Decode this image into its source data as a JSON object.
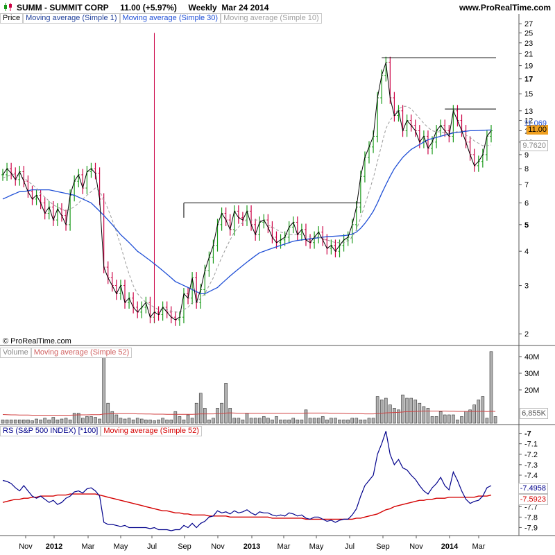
{
  "header": {
    "title": "SUMM - SUMMIT CORP     11.00 (+5.97%)     Weekly  Mar 24 2014",
    "site": "www.ProRealTime.com"
  },
  "copyright": "© ProRealTime.com",
  "legends": {
    "price": [
      "Price",
      "Moving average (Simple 1)",
      "Moving average (Simple 30)",
      "Moving average (Simple 10)"
    ],
    "volume": [
      "Volume",
      "Moving average (Simple 52)"
    ],
    "rs": [
      "RS (S&P 500 INDEX) [*100]",
      "Moving average (Simple 52)"
    ]
  },
  "value_tags": {
    "price_last": "11.00",
    "ma10_last": "9.7620",
    "ma30_last": "11.069",
    "volume_ma": "6,855K",
    "rs_last": "-7.4958",
    "rs_ma": "-7.5923"
  },
  "colors": {
    "up_bar": "#1a9a1a",
    "down_bar": "#cc0044",
    "ma1": "#000000",
    "ma30": "#1f4fd6",
    "ma10": "#9a9a9a",
    "rs_line": "#00008b",
    "rs_ma": "#d40000",
    "vol_bar": "#b0b0b0",
    "vol_ma": "#d04040",
    "price_tag_bg": "#f0a020"
  },
  "chart_data": [
    {
      "type": "line",
      "title": "SUMM - SUMMIT CORP",
      "panel": "price",
      "scale": "log",
      "ylim": [
        1.9,
        28
      ],
      "y_ticks": [
        2,
        3,
        4,
        5,
        6,
        7,
        8,
        9,
        10,
        11,
        12,
        13,
        15,
        17,
        19,
        21,
        23,
        25,
        27
      ],
      "x_ticks": [
        "Nov",
        "2012",
        "Mar",
        "May",
        "Jul",
        "Sep",
        "Nov",
        "2013",
        "Mar",
        "May",
        "Jul",
        "Sep",
        "Nov",
        "2014",
        "Mar"
      ],
      "series": [
        {
          "name": "Moving average (Simple 1)",
          "values": [
            7.6,
            8.0,
            7.7,
            7.3,
            7.8,
            7.2,
            6.6,
            6.2,
            6.4,
            6.0,
            5.5,
            5.8,
            5.2,
            5.7,
            5.4,
            5.0,
            6.4,
            7.2,
            7.6,
            6.8,
            7.8,
            8.0,
            7.7,
            6.2,
            3.5,
            3.2,
            3.0,
            2.8,
            3.0,
            2.6,
            2.7,
            2.5,
            2.4,
            2.5,
            2.6,
            2.3,
            2.4,
            2.35,
            2.5,
            2.4,
            2.3,
            2.25,
            2.3,
            2.8,
            2.7,
            3.2,
            2.6,
            2.9,
            3.4,
            3.8,
            4.2,
            5.0,
            5.5,
            5.2,
            4.8,
            5.6,
            5.3,
            5.2,
            5.6,
            5.0,
            4.6,
            5.1,
            5.2,
            4.9,
            4.5,
            4.3,
            4.4,
            4.5,
            4.9,
            5.1,
            4.6,
            4.8,
            4.4,
            4.3,
            4.5,
            4.7,
            4.4,
            4.1,
            4.2,
            4.0,
            4.2,
            4.4,
            4.5,
            5.0,
            5.8,
            7.5,
            8.8,
            9.6,
            10.5,
            14.5,
            17.5,
            19.5,
            14.5,
            12.5,
            13.0,
            11.0,
            12.0,
            11.5,
            11.0,
            10.0,
            10.5,
            9.5,
            10.0,
            11.0,
            11.5,
            11.0,
            10.5,
            13.0,
            12.0,
            11.0,
            10.0,
            9.0,
            8.2,
            8.5,
            9.0,
            10.5,
            11.0
          ]
        },
        {
          "name": "Moving average (Simple 10)",
          "values": [
            7.4,
            7.5,
            7.6,
            7.6,
            7.5,
            7.4,
            7.2,
            7.0,
            6.8,
            6.5,
            6.3,
            6.1,
            5.9,
            5.8,
            5.7,
            5.6,
            5.7,
            5.8,
            6.0,
            6.2,
            6.4,
            6.6,
            6.8,
            6.6,
            6.2,
            5.7,
            5.2,
            4.7,
            4.2,
            3.7,
            3.3,
            3.0,
            2.8,
            2.7,
            2.6,
            2.55,
            2.5,
            2.45,
            2.45,
            2.45,
            2.42,
            2.4,
            2.4,
            2.45,
            2.5,
            2.6,
            2.6,
            2.7,
            2.8,
            3.0,
            3.2,
            3.5,
            3.8,
            4.1,
            4.4,
            4.7,
            4.9,
            5.1,
            5.2,
            5.2,
            5.2,
            5.2,
            5.1,
            5.0,
            4.9,
            4.8,
            4.7,
            4.65,
            4.6,
            4.6,
            4.6,
            4.6,
            4.55,
            4.5,
            4.5,
            4.5,
            4.45,
            4.4,
            4.35,
            4.3,
            4.3,
            4.3,
            4.35,
            4.5,
            4.8,
            5.3,
            5.9,
            6.6,
            7.4,
            8.5,
            9.8,
            11.2,
            12.0,
            12.6,
            13.2,
            13.5,
            13.5,
            13.2,
            12.7,
            12.2,
            11.7,
            11.3,
            11.0,
            10.9,
            10.9,
            10.8,
            10.7,
            10.9,
            10.9,
            10.8,
            10.6,
            10.4,
            10.1,
            9.9,
            9.7,
            9.7,
            9.76
          ]
        },
        {
          "name": "Moving average (Simple 30)",
          "values": [
            6.2,
            6.3,
            6.4,
            6.5,
            6.6,
            6.6,
            6.65,
            6.7,
            6.7,
            6.7,
            6.7,
            6.7,
            6.65,
            6.6,
            6.55,
            6.5,
            6.45,
            6.4,
            6.3,
            6.2,
            6.1,
            6.0,
            5.8,
            5.6,
            5.4,
            5.2,
            5.0,
            4.8,
            4.6,
            4.45,
            4.3,
            4.15,
            4.0,
            3.9,
            3.8,
            3.7,
            3.6,
            3.5,
            3.4,
            3.3,
            3.2,
            3.1,
            3.05,
            3.0,
            2.95,
            2.9,
            2.85,
            2.8,
            2.8,
            2.85,
            2.9,
            2.95,
            3.05,
            3.15,
            3.25,
            3.35,
            3.45,
            3.55,
            3.65,
            3.75,
            3.85,
            3.95,
            4.0,
            4.05,
            4.1,
            4.15,
            4.2,
            4.25,
            4.3,
            4.35,
            4.38,
            4.4,
            4.42,
            4.44,
            4.46,
            4.48,
            4.5,
            4.52,
            4.53,
            4.54,
            4.55,
            4.56,
            4.58,
            4.62,
            4.7,
            4.85,
            5.05,
            5.3,
            5.6,
            6.0,
            6.5,
            7.0,
            7.5,
            8.0,
            8.4,
            8.8,
            9.1,
            9.4,
            9.6,
            9.8,
            10.0,
            10.2,
            10.3,
            10.4,
            10.5,
            10.6,
            10.7,
            10.8,
            10.85,
            10.9,
            10.95,
            11.0,
            11.0,
            11.02,
            11.04,
            11.06,
            11.07
          ]
        }
      ],
      "annotations": [
        "horizontal line at 6",
        "horizontal line at 20.3",
        "horizontal line at 13.2"
      ]
    },
    {
      "type": "bar",
      "panel": "volume",
      "ylim": [
        0,
        45
      ],
      "y_ticks": [
        "20M",
        "30M",
        "40M"
      ],
      "ylabel": "",
      "series": [
        {
          "name": "Volume",
          "values": [
            2,
            2,
            2,
            2,
            2,
            2,
            2,
            1.5,
            2.5,
            2,
            3,
            2,
            3.5,
            2,
            2.5,
            3,
            2,
            6,
            6,
            3,
            4,
            4,
            3.5,
            2.5,
            42,
            12,
            7,
            5,
            3,
            2.5,
            3,
            2,
            3,
            2.5,
            2,
            2,
            1.5,
            2,
            3,
            2,
            2,
            7,
            4,
            2,
            5,
            3,
            12,
            18,
            9,
            2,
            3,
            9,
            12,
            24,
            9,
            3,
            3,
            2,
            6,
            3,
            3,
            3,
            4,
            3,
            2,
            4,
            2,
            2,
            2,
            3,
            2,
            2,
            8,
            3,
            3,
            3,
            4,
            2,
            3,
            3,
            2,
            2,
            2,
            3,
            3,
            2,
            2,
            3,
            3,
            16,
            14,
            15,
            11,
            9,
            8,
            17,
            15,
            15,
            14,
            12,
            10,
            9,
            4,
            4,
            7,
            5,
            5,
            5,
            2,
            4,
            7,
            8,
            11,
            14,
            16,
            3,
            43,
            4
          ]
        },
        {
          "name": "Moving average (Simple 52)",
          "values": [
            5.2,
            5.1,
            5.0,
            5.0,
            4.9,
            4.9,
            4.9,
            4.8,
            4.8,
            4.8,
            4.8,
            4.8,
            4.8,
            4.8,
            4.8,
            4.8,
            4.8,
            4.9,
            5.0,
            5.0,
            5.0,
            5.1,
            5.1,
            5.1,
            5.5,
            5.6,
            5.7,
            5.7,
            5.7,
            5.7,
            5.7,
            5.7,
            5.6,
            5.6,
            5.5,
            5.5,
            5.4,
            5.4,
            5.4,
            5.3,
            5.3,
            5.3,
            5.3,
            5.3,
            5.3,
            5.3,
            5.4,
            5.6,
            5.6,
            5.6,
            5.6,
            5.7,
            5.8,
            6.1,
            6.2,
            6.1,
            6.0,
            6.0,
            6.0,
            6.0,
            6.0,
            6.0,
            6.0,
            6.0,
            6.0,
            6.0,
            6.0,
            6.0,
            6.0,
            6.0,
            6.0,
            6.0,
            6.1,
            6.1,
            6.1,
            6.1,
            6.1,
            6.1,
            6.0,
            6.0,
            6.0,
            5.9,
            5.8,
            5.8,
            5.7,
            5.7,
            5.6,
            5.6,
            5.6,
            5.8,
            6.0,
            6.2,
            6.3,
            6.4,
            6.5,
            6.7,
            6.9,
            7.0,
            7.1,
            7.2,
            7.3,
            7.3,
            7.3,
            7.3,
            7.3,
            7.3,
            7.2,
            7.2,
            7.1,
            7.1,
            7.1,
            7.1,
            7.1,
            7.1,
            7.2,
            7.0,
            7.2,
            7.1
          ]
        }
      ]
    },
    {
      "type": "line",
      "panel": "rs",
      "ylim": [
        -7.95,
        -6.95
      ],
      "y_ticks": [
        -7,
        -7.1,
        -7.2,
        -7.3,
        -7.4,
        -7.5,
        -7.6,
        -7.7,
        -7.8,
        -7.9
      ],
      "series": [
        {
          "name": "RS (S&P 500 INDEX) [*100]",
          "values": [
            -7.45,
            -7.46,
            -7.48,
            -7.52,
            -7.55,
            -7.5,
            -7.55,
            -7.6,
            -7.62,
            -7.6,
            -7.63,
            -7.66,
            -7.64,
            -7.68,
            -7.66,
            -7.62,
            -7.6,
            -7.56,
            -7.55,
            -7.57,
            -7.53,
            -7.52,
            -7.55,
            -7.6,
            -7.85,
            -7.87,
            -7.87,
            -7.88,
            -7.89,
            -7.88,
            -7.9,
            -7.9,
            -7.9,
            -7.9,
            -7.9,
            -7.91,
            -7.9,
            -7.92,
            -7.92,
            -7.92,
            -7.93,
            -7.92,
            -7.92,
            -7.88,
            -7.9,
            -7.86,
            -7.9,
            -7.86,
            -7.84,
            -7.8,
            -7.79,
            -7.74,
            -7.76,
            -7.75,
            -7.77,
            -7.74,
            -7.76,
            -7.75,
            -7.73,
            -7.76,
            -7.78,
            -7.75,
            -7.76,
            -7.76,
            -7.78,
            -7.79,
            -7.78,
            -7.79,
            -7.76,
            -7.77,
            -7.79,
            -7.78,
            -7.81,
            -7.82,
            -7.8,
            -7.8,
            -7.82,
            -7.84,
            -7.83,
            -7.85,
            -7.83,
            -7.82,
            -7.82,
            -7.78,
            -7.72,
            -7.6,
            -7.5,
            -7.45,
            -7.4,
            -7.2,
            -7.1,
            -6.98,
            -7.2,
            -7.3,
            -7.25,
            -7.33,
            -7.35,
            -7.4,
            -7.44,
            -7.5,
            -7.55,
            -7.58,
            -7.52,
            -7.48,
            -7.42,
            -7.5,
            -7.54,
            -7.37,
            -7.45,
            -7.55,
            -7.63,
            -7.67,
            -7.65,
            -7.64,
            -7.6,
            -7.52,
            -7.5
          ]
        },
        {
          "name": "Moving average (Simple 52)",
          "values": [
            -7.66,
            -7.65,
            -7.64,
            -7.63,
            -7.63,
            -7.62,
            -7.62,
            -7.61,
            -7.61,
            -7.6,
            -7.6,
            -7.6,
            -7.6,
            -7.59,
            -7.59,
            -7.59,
            -7.58,
            -7.58,
            -7.58,
            -7.58,
            -7.58,
            -7.58,
            -7.58,
            -7.59,
            -7.6,
            -7.61,
            -7.62,
            -7.63,
            -7.64,
            -7.65,
            -7.66,
            -7.67,
            -7.68,
            -7.69,
            -7.7,
            -7.71,
            -7.72,
            -7.73,
            -7.74,
            -7.74,
            -7.75,
            -7.76,
            -7.76,
            -7.77,
            -7.77,
            -7.78,
            -7.78,
            -7.78,
            -7.78,
            -7.79,
            -7.79,
            -7.79,
            -7.79,
            -7.79,
            -7.8,
            -7.8,
            -7.8,
            -7.8,
            -7.8,
            -7.8,
            -7.8,
            -7.8,
            -7.8,
            -7.8,
            -7.81,
            -7.81,
            -7.81,
            -7.81,
            -7.81,
            -7.81,
            -7.81,
            -7.81,
            -7.82,
            -7.82,
            -7.82,
            -7.82,
            -7.82,
            -7.82,
            -7.82,
            -7.82,
            -7.82,
            -7.82,
            -7.82,
            -7.82,
            -7.81,
            -7.81,
            -7.8,
            -7.79,
            -7.78,
            -7.77,
            -7.75,
            -7.73,
            -7.72,
            -7.7,
            -7.69,
            -7.68,
            -7.67,
            -7.66,
            -7.65,
            -7.64,
            -7.64,
            -7.63,
            -7.63,
            -7.62,
            -7.62,
            -7.62,
            -7.61,
            -7.61,
            -7.61,
            -7.61,
            -7.61,
            -7.61,
            -7.61,
            -7.6,
            -7.6,
            -7.6,
            -7.59
          ]
        }
      ]
    }
  ]
}
